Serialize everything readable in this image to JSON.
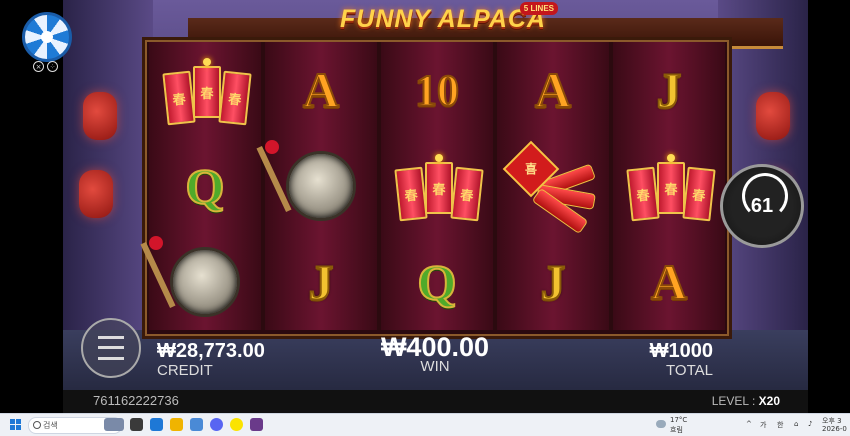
{
  "game": {
    "title": "FUNNY ALPACA",
    "lines_badge": "5 LINES"
  },
  "reels": [
    [
      "firecrackers",
      "Q",
      "gong"
    ],
    [
      "A",
      "gong",
      "J"
    ],
    [
      "10",
      "firecrackers",
      "Q"
    ],
    [
      "A",
      "firecracker-bundle",
      "J"
    ],
    [
      "J",
      "firecrackers",
      "A"
    ]
  ],
  "firecracker_glyph": "春",
  "bundle_glyph": "喜",
  "spin": {
    "count": "61"
  },
  "credit": {
    "value": "₩28,773.00",
    "label": "CREDIT"
  },
  "win": {
    "value": "₩400.00",
    "label": "WIN"
  },
  "total": {
    "value": "₩1000",
    "label": "TOTAL"
  },
  "footer": {
    "game_id": "761162222736",
    "level_label": "LEVEL :",
    "level_value": "X20"
  },
  "taskbar": {
    "search_placeholder": "검색",
    "weather_temp": "17°C",
    "weather_desc": "흐림",
    "ime_1": "가",
    "ime_2": "한",
    "time": "오후 3",
    "date": "2026-0"
  },
  "colors": {
    "brand_gold": "#ffd24a",
    "reel_red": "#6b1430",
    "taskbar": "#eef1f6"
  }
}
